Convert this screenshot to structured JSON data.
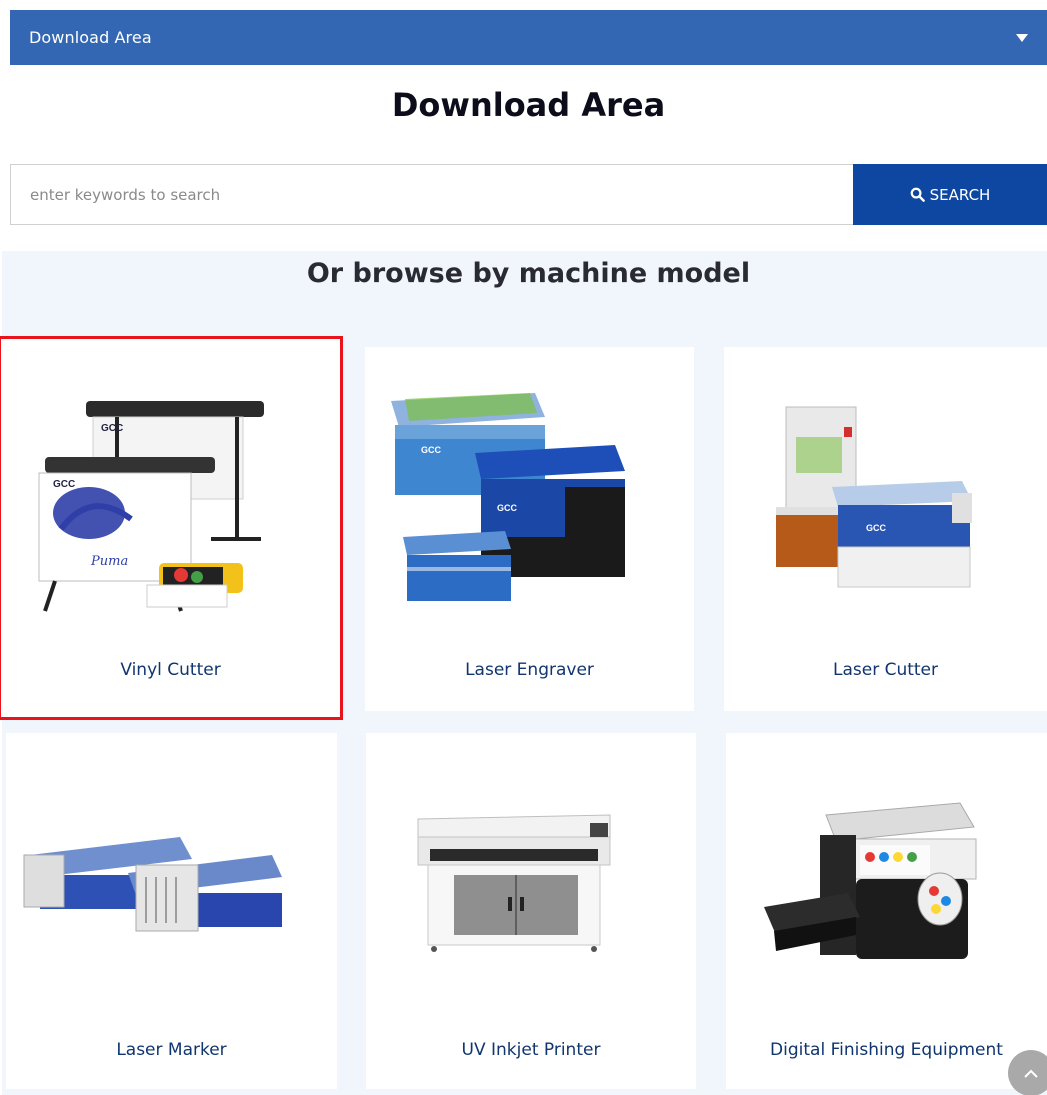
{
  "dropdown": {
    "label": "Download Area",
    "icon": "caret-down-icon"
  },
  "page_title": "Download Area",
  "search": {
    "placeholder": "enter keywords to search",
    "value": "",
    "button_label": "SEARCH",
    "button_icon": "search-icon",
    "button_color": "#0d47a1"
  },
  "browse": {
    "title": "Or browse by machine model",
    "categories": [
      {
        "label": "Vinyl Cutter",
        "selected": true
      },
      {
        "label": "Laser Engraver",
        "selected": false
      },
      {
        "label": "Laser Cutter",
        "selected": false
      },
      {
        "label": "Laser Marker",
        "selected": false
      },
      {
        "label": "UV Inkjet Printer",
        "selected": false
      },
      {
        "label": "Digital Finishing Equipment",
        "selected": false
      }
    ]
  },
  "colors": {
    "brand_bar": "#3467b3",
    "highlight": "#e8131b",
    "category_text": "#10356f"
  }
}
